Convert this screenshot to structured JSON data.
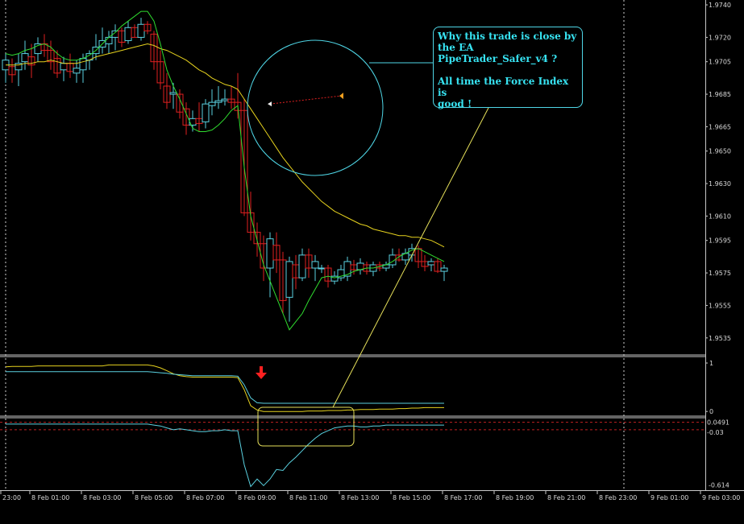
{
  "chart_data": {
    "type": "candlestick",
    "price_axis": {
      "ticks": [
        "1.9740",
        "1.9720",
        "1.9705",
        "1.9685",
        "1.9665",
        "1.9650",
        "1.9630",
        "1.9610",
        "1.9595",
        "1.9575",
        "1.9555",
        "1.9535"
      ],
      "ylim": [
        1.9525,
        1.9742
      ]
    },
    "time_axis": {
      "labels": [
        "23:00",
        "8 Feb 01:00",
        "8 Feb 03:00",
        "8 Feb 05:00",
        "8 Feb 07:00",
        "8 Feb 09:00",
        "8 Feb 11:00",
        "8 Feb 13:00",
        "8 Feb 15:00",
        "8 Feb 17:00",
        "8 Feb 19:00",
        "8 Feb 21:00",
        "8 Feb 23:00",
        "9 Feb 01:00",
        "9 Feb 03:00"
      ]
    },
    "candles": [
      {
        "o": 1.97,
        "h": 1.971,
        "l": 1.9692,
        "c": 1.9706
      },
      {
        "o": 1.9702,
        "h": 1.9707,
        "l": 1.9692,
        "c": 1.9697
      },
      {
        "o": 1.97,
        "h": 1.971,
        "l": 1.969,
        "c": 1.9704
      },
      {
        "o": 1.9705,
        "h": 1.9718,
        "l": 1.97,
        "c": 1.971
      },
      {
        "o": 1.9708,
        "h": 1.9716,
        "l": 1.9695,
        "c": 1.9703
      },
      {
        "o": 1.971,
        "h": 1.972,
        "l": 1.9705,
        "c": 1.9716
      },
      {
        "o": 1.9716,
        "h": 1.9722,
        "l": 1.9708,
        "c": 1.9712
      },
      {
        "o": 1.9712,
        "h": 1.9718,
        "l": 1.97,
        "c": 1.9705
      },
      {
        "o": 1.9707,
        "h": 1.9712,
        "l": 1.9695,
        "c": 1.9698
      },
      {
        "o": 1.97,
        "h": 1.9708,
        "l": 1.9693,
        "c": 1.9704
      },
      {
        "o": 1.9704,
        "h": 1.971,
        "l": 1.9695,
        "c": 1.9699
      },
      {
        "o": 1.9698,
        "h": 1.9706,
        "l": 1.9692,
        "c": 1.9701
      },
      {
        "o": 1.97,
        "h": 1.971,
        "l": 1.9692,
        "c": 1.9707
      },
      {
        "o": 1.9706,
        "h": 1.9712,
        "l": 1.97,
        "c": 1.971
      },
      {
        "o": 1.971,
        "h": 1.9722,
        "l": 1.9706,
        "c": 1.9714
      },
      {
        "o": 1.9714,
        "h": 1.9726,
        "l": 1.971,
        "c": 1.9718
      },
      {
        "o": 1.9716,
        "h": 1.9724,
        "l": 1.971,
        "c": 1.972
      },
      {
        "o": 1.972,
        "h": 1.9728,
        "l": 1.9712,
        "c": 1.9724
      },
      {
        "o": 1.9724,
        "h": 1.9726,
        "l": 1.9714,
        "c": 1.9717
      },
      {
        "o": 1.9718,
        "h": 1.973,
        "l": 1.9716,
        "c": 1.9726
      },
      {
        "o": 1.9726,
        "h": 1.9728,
        "l": 1.972,
        "c": 1.972
      },
      {
        "o": 1.972,
        "h": 1.9732,
        "l": 1.9718,
        "c": 1.9728
      },
      {
        "o": 1.9728,
        "h": 1.973,
        "l": 1.9722,
        "c": 1.9724
      },
      {
        "o": 1.9722,
        "h": 1.9724,
        "l": 1.97,
        "c": 1.9705
      },
      {
        "o": 1.9705,
        "h": 1.9712,
        "l": 1.9688,
        "c": 1.9692
      },
      {
        "o": 1.969,
        "h": 1.9698,
        "l": 1.9676,
        "c": 1.968
      },
      {
        "o": 1.9685,
        "h": 1.9692,
        "l": 1.9676,
        "c": 1.9686
      },
      {
        "o": 1.9685,
        "h": 1.9688,
        "l": 1.967,
        "c": 1.9674
      },
      {
        "o": 1.9676,
        "h": 1.968,
        "l": 1.966,
        "c": 1.9666
      },
      {
        "o": 1.9666,
        "h": 1.9675,
        "l": 1.9662,
        "c": 1.967
      },
      {
        "o": 1.967,
        "h": 1.968,
        "l": 1.9662,
        "c": 1.9667
      },
      {
        "o": 1.9668,
        "h": 1.9682,
        "l": 1.9664,
        "c": 1.9679
      },
      {
        "o": 1.9678,
        "h": 1.9688,
        "l": 1.9672,
        "c": 1.968
      },
      {
        "o": 1.968,
        "h": 1.969,
        "l": 1.9676,
        "c": 1.9681
      },
      {
        "o": 1.9681,
        "h": 1.9688,
        "l": 1.9678,
        "c": 1.9682
      },
      {
        "o": 1.9682,
        "h": 1.969,
        "l": 1.9676,
        "c": 1.968
      },
      {
        "o": 1.968,
        "h": 1.9698,
        "l": 1.967,
        "c": 1.9675
      },
      {
        "o": 1.9675,
        "h": 1.9682,
        "l": 1.961,
        "c": 1.9612
      },
      {
        "o": 1.9612,
        "h": 1.9625,
        "l": 1.9595,
        "c": 1.96
      },
      {
        "o": 1.96,
        "h": 1.9606,
        "l": 1.9585,
        "c": 1.9593
      },
      {
        "o": 1.9593,
        "h": 1.9598,
        "l": 1.957,
        "c": 1.9578
      },
      {
        "o": 1.9578,
        "h": 1.96,
        "l": 1.956,
        "c": 1.9596
      },
      {
        "o": 1.9592,
        "h": 1.96,
        "l": 1.9575,
        "c": 1.9583
      },
      {
        "o": 1.9583,
        "h": 1.9588,
        "l": 1.955,
        "c": 1.9558
      },
      {
        "o": 1.956,
        "h": 1.9585,
        "l": 1.9545,
        "c": 1.9582
      },
      {
        "o": 1.958,
        "h": 1.9586,
        "l": 1.9565,
        "c": 1.9572
      },
      {
        "o": 1.9572,
        "h": 1.959,
        "l": 1.957,
        "c": 1.9586
      },
      {
        "o": 1.9586,
        "h": 1.959,
        "l": 1.9572,
        "c": 1.9578
      },
      {
        "o": 1.9578,
        "h": 1.9586,
        "l": 1.957,
        "c": 1.9582
      },
      {
        "o": 1.9578,
        "h": 1.958,
        "l": 1.9575,
        "c": 1.9578
      },
      {
        "o": 1.9578,
        "h": 1.958,
        "l": 1.9566,
        "c": 1.957
      },
      {
        "o": 1.957,
        "h": 1.9576,
        "l": 1.9568,
        "c": 1.9573
      },
      {
        "o": 1.9572,
        "h": 1.958,
        "l": 1.957,
        "c": 1.9577
      },
      {
        "o": 1.9573,
        "h": 1.9585,
        "l": 1.957,
        "c": 1.9582
      },
      {
        "o": 1.958,
        "h": 1.9583,
        "l": 1.9574,
        "c": 1.9577
      },
      {
        "o": 1.9577,
        "h": 1.9584,
        "l": 1.9574,
        "c": 1.9581
      },
      {
        "o": 1.958,
        "h": 1.9582,
        "l": 1.9574,
        "c": 1.9576
      },
      {
        "o": 1.9576,
        "h": 1.9582,
        "l": 1.9573,
        "c": 1.958
      },
      {
        "o": 1.958,
        "h": 1.9582,
        "l": 1.9576,
        "c": 1.9578
      },
      {
        "o": 1.9578,
        "h": 1.9582,
        "l": 1.9576,
        "c": 1.958
      },
      {
        "o": 1.958,
        "h": 1.959,
        "l": 1.9578,
        "c": 1.9586
      },
      {
        "o": 1.9586,
        "h": 1.959,
        "l": 1.9582,
        "c": 1.9583
      },
      {
        "o": 1.9583,
        "h": 1.959,
        "l": 1.958,
        "c": 1.9587
      },
      {
        "o": 1.9586,
        "h": 1.9593,
        "l": 1.9582,
        "c": 1.959
      },
      {
        "o": 1.959,
        "h": 1.9592,
        "l": 1.9578,
        "c": 1.9582
      },
      {
        "o": 1.9582,
        "h": 1.9586,
        "l": 1.9576,
        "c": 1.9579
      },
      {
        "o": 1.958,
        "h": 1.9584,
        "l": 1.9576,
        "c": 1.9582
      },
      {
        "o": 1.9582,
        "h": 1.9584,
        "l": 1.9575,
        "c": 1.9576
      },
      {
        "o": 1.9576,
        "h": 1.958,
        "l": 1.957,
        "c": 1.9578
      }
    ],
    "bull_color": "#5ad1e0",
    "bear_color": "#e02020",
    "ma_fast": {
      "color": "#2fdc2f",
      "values": [
        1.971,
        1.9709,
        1.971,
        1.9712,
        1.9713,
        1.9715,
        1.9716,
        1.9714,
        1.971,
        1.9707,
        1.9706,
        1.9706,
        1.9707,
        1.9709,
        1.9712,
        1.9716,
        1.972,
        1.9723,
        1.9727,
        1.973,
        1.9733,
        1.9736,
        1.9736,
        1.973,
        1.9716,
        1.97,
        1.969,
        1.9682,
        1.9673,
        1.9664,
        1.9662,
        1.9662,
        1.9663,
        1.9666,
        1.967,
        1.9675,
        1.9678,
        1.964,
        1.961,
        1.9595,
        1.958,
        1.957,
        1.956,
        1.955,
        1.954,
        1.9545,
        1.955,
        1.9558,
        1.9565,
        1.9572,
        1.9573,
        1.9572,
        1.9573,
        1.9574,
        1.9576,
        1.9577,
        1.9578,
        1.9578,
        1.9579,
        1.958,
        1.9582,
        1.9585,
        1.9587,
        1.9589,
        1.959,
        1.9588,
        1.9586,
        1.9584,
        1.9582
      ]
    },
    "ma_slow": {
      "color": "#e6d21e",
      "values": [
        1.9703,
        1.9703,
        1.9703,
        1.9704,
        1.9704,
        1.9705,
        1.9705,
        1.9706,
        1.9705,
        1.9704,
        1.9704,
        1.9704,
        1.9705,
        1.9706,
        1.9708,
        1.9709,
        1.971,
        1.9711,
        1.9712,
        1.9713,
        1.9714,
        1.9715,
        1.9716,
        1.9715,
        1.9713,
        1.9712,
        1.971,
        1.9708,
        1.9706,
        1.9703,
        1.97,
        1.9698,
        1.9695,
        1.9693,
        1.9691,
        1.969,
        1.9688,
        1.9682,
        1.9676,
        1.967,
        1.9664,
        1.9658,
        1.9652,
        1.9646,
        1.9641,
        1.9636,
        1.9631,
        1.9627,
        1.9623,
        1.9619,
        1.9616,
        1.9613,
        1.9611,
        1.9609,
        1.9607,
        1.9605,
        1.9604,
        1.9602,
        1.9601,
        1.96,
        1.9599,
        1.9598,
        1.9598,
        1.9597,
        1.9597,
        1.9596,
        1.9595,
        1.9593,
        1.9591
      ]
    },
    "trend_panel": {
      "ticks": [
        "1",
        "0"
      ],
      "ylim": [
        -0.08,
        1.1
      ],
      "yellow": {
        "color": "#e6d21e",
        "values": [
          0.92,
          0.93,
          0.93,
          0.93,
          0.93,
          0.94,
          0.94,
          0.94,
          0.94,
          0.94,
          0.94,
          0.94,
          0.94,
          0.94,
          0.94,
          0.94,
          0.96,
          0.96,
          0.96,
          0.96,
          0.96,
          0.96,
          0.96,
          0.94,
          0.9,
          0.84,
          0.78,
          0.74,
          0.72,
          0.71,
          0.71,
          0.71,
          0.71,
          0.71,
          0.71,
          0.71,
          0.7,
          0.45,
          0.12,
          0.03,
          0.0,
          0.0,
          0.0,
          0.0,
          0.0,
          0.0,
          0.0,
          0.01,
          0.01,
          0.01,
          0.02,
          0.02,
          0.02,
          0.03,
          0.03,
          0.04,
          0.04,
          0.04,
          0.05,
          0.05,
          0.05,
          0.06,
          0.06,
          0.07,
          0.07,
          0.08,
          0.08,
          0.08,
          0.08
        ]
      },
      "cyan": {
        "color": "#5ad1e0",
        "values": [
          0.82,
          0.82,
          0.82,
          0.82,
          0.82,
          0.82,
          0.82,
          0.82,
          0.82,
          0.82,
          0.82,
          0.82,
          0.82,
          0.82,
          0.82,
          0.82,
          0.82,
          0.82,
          0.82,
          0.82,
          0.82,
          0.82,
          0.82,
          0.81,
          0.8,
          0.79,
          0.77,
          0.76,
          0.75,
          0.74,
          0.74,
          0.74,
          0.74,
          0.74,
          0.74,
          0.74,
          0.73,
          0.55,
          0.28,
          0.18,
          0.17,
          0.17,
          0.17,
          0.17,
          0.17,
          0.17,
          0.17,
          0.17,
          0.17,
          0.17,
          0.17,
          0.17,
          0.17,
          0.17,
          0.17,
          0.17,
          0.17,
          0.17,
          0.17,
          0.17,
          0.17,
          0.17,
          0.17,
          0.17,
          0.17,
          0.17,
          0.17,
          0.17,
          0.17
        ]
      }
    },
    "force_index": {
      "ticks": [
        "0.0491",
        "-0.03",
        "-0.614"
      ],
      "ylim": [
        -0.66,
        0.08
      ],
      "level_color": "#c02020",
      "color": "#5ad1e0",
      "values": [
        0.03,
        0.03,
        0.03,
        0.03,
        0.03,
        0.03,
        0.03,
        0.03,
        0.03,
        0.03,
        0.03,
        0.03,
        0.03,
        0.03,
        0.03,
        0.03,
        0.03,
        0.03,
        0.03,
        0.03,
        0.03,
        0.03,
        0.03,
        0.02,
        0.01,
        -0.01,
        -0.03,
        -0.02,
        -0.03,
        -0.04,
        -0.05,
        -0.05,
        -0.04,
        -0.04,
        -0.03,
        -0.04,
        -0.04,
        -0.4,
        -0.63,
        -0.55,
        -0.62,
        -0.55,
        -0.45,
        -0.46,
        -0.38,
        -0.32,
        -0.25,
        -0.18,
        -0.12,
        -0.07,
        -0.04,
        -0.01,
        0.0,
        0.01,
        0.01,
        0.0,
        0.0,
        0.01,
        0.01,
        0.02,
        0.02,
        0.02,
        0.02,
        0.02,
        0.02,
        0.02,
        0.02,
        0.02,
        0.02
      ]
    }
  },
  "annotation": {
    "lines": [
      "Why this trade is close by",
      "the EA",
      "PipeTrader_Safer_v4 ?",
      "",
      "All time the Force Index is",
      "good !"
    ],
    "color": "#37e3f2"
  }
}
